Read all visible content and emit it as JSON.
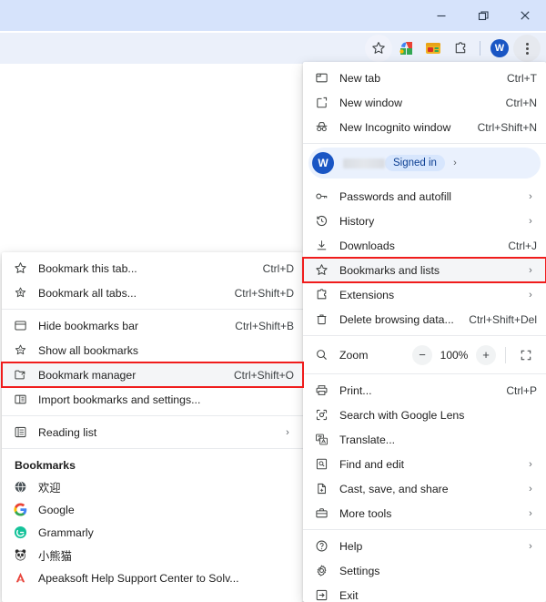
{
  "window": {
    "controls": [
      {
        "name": "minimize",
        "label": "–"
      },
      {
        "name": "restore",
        "label": "❐"
      },
      {
        "name": "close",
        "label": "✕"
      }
    ]
  },
  "toolbar": {
    "icons": [
      {
        "name": "bookmark-star-icon",
        "label": "☆"
      },
      {
        "name": "google-apps-icon",
        "label": ""
      },
      {
        "name": "extension-card-icon",
        "label": ""
      },
      {
        "name": "extensions-puzzle-icon",
        "label": ""
      },
      {
        "name": "profile-avatar",
        "label": "W"
      },
      {
        "name": "chrome-menu-icon",
        "label": "⋮"
      }
    ]
  },
  "main_menu": {
    "groups": [
      {
        "items": [
          {
            "icon": "new-tab-icon",
            "label": "New tab",
            "accel": "Ctrl+T",
            "arrow": false
          },
          {
            "icon": "new-window-icon",
            "label": "New window",
            "accel": "Ctrl+N",
            "arrow": false
          },
          {
            "icon": "incognito-icon",
            "label": "New Incognito window",
            "accel": "Ctrl+Shift+N",
            "arrow": false
          }
        ]
      },
      {
        "account": {
          "avatar_letter": "W",
          "name": "",
          "status": "Signed in",
          "arrow": "›"
        }
      },
      {
        "items": [
          {
            "icon": "passwords-key-icon",
            "label": "Passwords and autofill",
            "accel": "",
            "arrow": true
          },
          {
            "icon": "history-clock-icon",
            "label": "History",
            "accel": "",
            "arrow": true
          },
          {
            "icon": "downloads-icon",
            "label": "Downloads",
            "accel": "Ctrl+J",
            "arrow": false
          },
          {
            "icon": "bookmarks-star-icon",
            "label": "Bookmarks and lists",
            "accel": "",
            "arrow": true,
            "highlight": true
          },
          {
            "icon": "extensions-puzzle-icon",
            "label": "Extensions",
            "accel": "",
            "arrow": true
          },
          {
            "icon": "delete-trash-icon",
            "label": "Delete browsing data...",
            "accel": "Ctrl+Shift+Del",
            "arrow": false
          }
        ]
      },
      {
        "zoom": {
          "icon": "zoom-magnifier-icon",
          "label": "Zoom",
          "minus": "−",
          "level": "100%",
          "plus": "+",
          "fullscreen_icon": "fullscreen-icon"
        }
      },
      {
        "items": [
          {
            "icon": "print-icon",
            "label": "Print...",
            "accel": "Ctrl+P",
            "arrow": false
          },
          {
            "icon": "google-lens-icon",
            "label": "Search with Google Lens",
            "accel": "",
            "arrow": false
          },
          {
            "icon": "translate-icon",
            "label": "Translate...",
            "accel": "",
            "arrow": false
          },
          {
            "icon": "find-edit-icon",
            "label": "Find and edit",
            "accel": "",
            "arrow": true
          },
          {
            "icon": "cast-save-share-icon",
            "label": "Cast, save, and share",
            "accel": "",
            "arrow": true
          },
          {
            "icon": "more-tools-icon",
            "label": "More tools",
            "accel": "",
            "arrow": true
          }
        ]
      },
      {
        "items": [
          {
            "icon": "help-icon",
            "label": "Help",
            "accel": "",
            "arrow": true
          },
          {
            "icon": "settings-gear-icon",
            "label": "Settings",
            "accel": "",
            "arrow": false
          },
          {
            "icon": "exit-icon",
            "label": "Exit",
            "accel": "",
            "arrow": false
          }
        ]
      }
    ]
  },
  "bookmarks_submenu": {
    "groups": [
      {
        "items": [
          {
            "icon": "bookmark-star-icon",
            "label": "Bookmark this tab...",
            "accel": "Ctrl+D",
            "arrow": false
          },
          {
            "icon": "bookmark-all-tabs-icon",
            "label": "Bookmark all tabs...",
            "accel": "Ctrl+Shift+D",
            "arrow": false
          }
        ]
      },
      {
        "items": [
          {
            "icon": "bookmarks-bar-icon",
            "label": "Hide bookmarks bar",
            "accel": "Ctrl+Shift+B",
            "arrow": false
          },
          {
            "icon": "show-all-bookmarks-icon",
            "label": "Show all bookmarks",
            "accel": "",
            "arrow": false
          },
          {
            "icon": "bookmark-manager-icon",
            "label": "Bookmark manager",
            "accel": "Ctrl+Shift+O",
            "arrow": false,
            "highlight": true
          },
          {
            "icon": "import-bookmarks-icon",
            "label": "Import bookmarks and settings...",
            "accel": "",
            "arrow": false
          }
        ]
      },
      {
        "items": [
          {
            "icon": "reading-list-icon",
            "label": "Reading list",
            "accel": "",
            "arrow": true
          }
        ]
      }
    ],
    "bookmarks_heading": "Bookmarks",
    "bookmarks": [
      {
        "favicon": "globe-favicon",
        "label": "欢迎"
      },
      {
        "favicon": "google-favicon",
        "label": "Google"
      },
      {
        "favicon": "grammarly-favicon",
        "label": "Grammarly"
      },
      {
        "favicon": "panda-favicon",
        "label": "小熊猫"
      },
      {
        "favicon": "apeaksoft-favicon",
        "label": "Apeaksoft Help Support Center to Solv..."
      }
    ]
  },
  "colors": {
    "titlebar": "#d6e3fb",
    "toolbar": "#ebf0fa",
    "highlight_border": "#f01c1c",
    "accent_blue": "#1a56c4",
    "pill_bg": "#d7e6fd"
  }
}
